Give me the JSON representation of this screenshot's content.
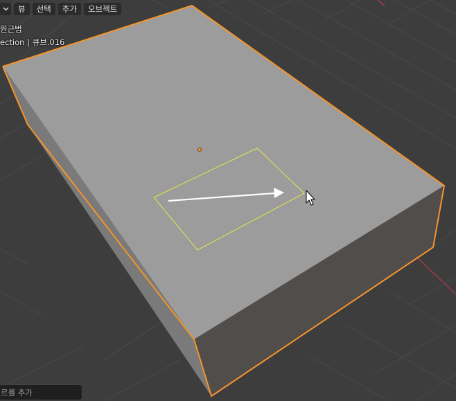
{
  "header": {
    "menu_items": [
      "뷰",
      "선택",
      "추가",
      "오브젝트"
    ]
  },
  "overlay": {
    "view_name": "원근법",
    "collection_line": "ection | 큐브.016"
  },
  "bottom": {
    "search_placeholder": "르를 추가"
  },
  "colors": {
    "background": "#3d3d3d",
    "selection_outline": "#f5952b",
    "box_select": "#e6e64d",
    "top_face": "#9c9c9c",
    "left_face": "#7a7a7a",
    "front_face": "#514d4b",
    "grid_line": "#4a4a4a",
    "x_axis": "#a03a4a"
  },
  "icons": [
    "chevron-down-icon",
    "mouse-cursor-icon",
    "origin-dot-icon",
    "drag-arrow-icon"
  ]
}
